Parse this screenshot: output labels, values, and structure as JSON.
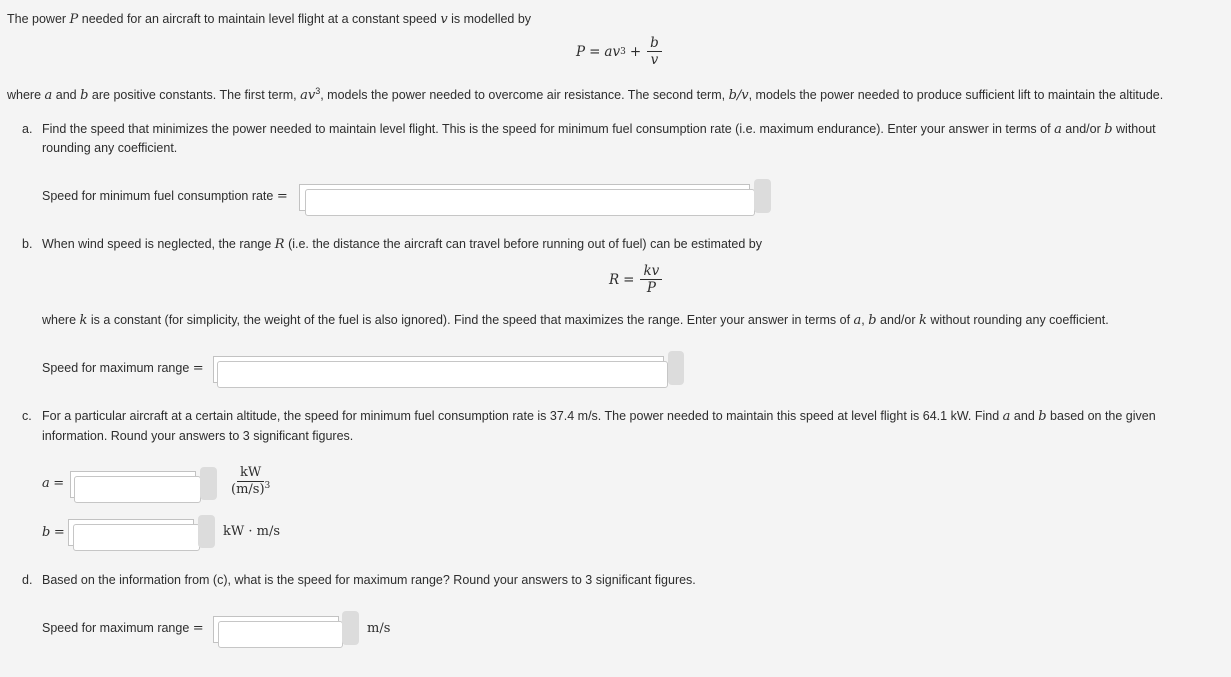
{
  "intro": {
    "line1_pre": "The power ",
    "line1_var_P": "P",
    "line1_mid": " needed for an aircraft to maintain level flight at a constant speed ",
    "line1_var_v": "v",
    "line1_post": " is modelled by",
    "formula": {
      "lhs": "P",
      "eq": "=",
      "term1": "av",
      "exp": "3",
      "plus": "+",
      "num": "b",
      "den": "v"
    },
    "line2_pre": "where ",
    "line2_a": "a",
    "line2_and": " and ",
    "line2_b": "b",
    "line2_mid1": " are positive constants. The first term, ",
    "line2_term1": "av",
    "line2_exp": "3",
    "line2_mid2": ", models the power needed to overcome air resistance. The second term, ",
    "line2_term2": "b/v",
    "line2_post": ", models the power needed to produce sufficient lift to maintain the altitude."
  },
  "part_a": {
    "marker": "a.",
    "text1_pre": "Find the speed that minimizes the power needed to maintain level flight. This is the speed for minimum fuel consumption rate (i.e. maximum endurance). Enter your answer in terms of ",
    "text1_a": "a",
    "text1_mid": " and/or ",
    "text1_b": "b",
    "text1_post": " without",
    "text2": "rounding any coefficient.",
    "answer_label": "Speed for minimum fuel consumption rate",
    "equals": "=",
    "answer_value": ""
  },
  "part_b": {
    "marker": "b.",
    "text1_pre": "When wind speed is neglected, the range ",
    "text1_R": "R",
    "text1_post": " (i.e. the distance the aircraft can travel before running out of fuel) can be estimated by",
    "formula": {
      "lhs": "R",
      "eq": "=",
      "num": "kv",
      "den": "P"
    },
    "text2_pre": "where ",
    "text2_k": "k",
    "text2_mid": " is a constant (for simplicity, the weight of the fuel is also ignored). Find the speed that maximizes the range. Enter your answer in terms of ",
    "text2_a": "a",
    "text2_comma": ", ",
    "text2_b": "b",
    "text2_andor": " and/or ",
    "text2_k2": "k",
    "text2_post": " without rounding any coefficient.",
    "answer_label": "Speed for maximum range",
    "equals": "=",
    "answer_value": ""
  },
  "part_c": {
    "marker": "c.",
    "text1_pre": "For a particular aircraft at a certain altitude, the speed for minimum fuel consumption rate is 37.4 m/s. The power needed to maintain this speed at level flight is 64.1 kW. Find ",
    "text1_a": "a",
    "text1_mid": " and ",
    "text1_b": "b",
    "text1_post": " based on the given",
    "text2": "information. Round your answers to 3 significant figures.",
    "a_label": "a",
    "b_label": "b",
    "equals": "=",
    "a_value": "",
    "b_value": "",
    "a_unit_num": "kW",
    "a_unit_den": "(m/s)",
    "a_unit_exp": "3",
    "b_unit": "kW · m/s"
  },
  "part_d": {
    "marker": "d.",
    "text": "Based on the information from (c), what is the speed for maximum range? Round your answers to 3 significant figures.",
    "answer_label": "Speed for maximum range",
    "equals": "=",
    "answer_value": "",
    "unit": "m/s"
  }
}
